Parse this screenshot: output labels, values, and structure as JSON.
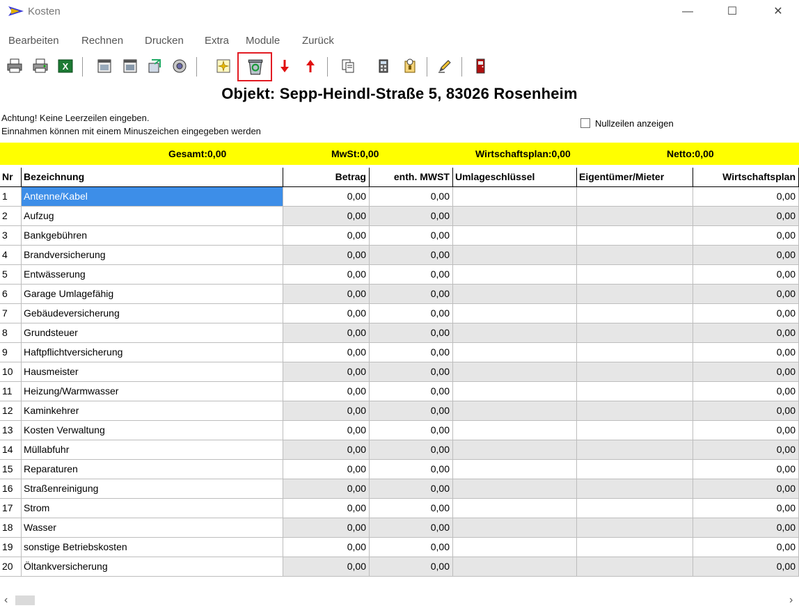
{
  "window": {
    "title": "Kosten"
  },
  "menu": [
    "Bearbeiten",
    "Rechnen",
    "Drucken",
    "Extra",
    "Module",
    "Zurück"
  ],
  "heading": "Objekt: Sepp-Heindl-Straße 5, 83026 Rosenheim",
  "notes": {
    "line1": "Achtung!  Keine Leerzeilen eingeben.",
    "line2": "Einnahmen können mit einem  Minuszeichen eingegeben werden"
  },
  "null_rows_label": "Nullzeilen anzeigen",
  "totals": {
    "gesamt": "Gesamt:0,00",
    "mwst": "MwSt:0,00",
    "wirtschaftsplan": "Wirtschaftsplan:0,00",
    "netto": "Netto:0,00"
  },
  "table": {
    "headers": [
      "Nr",
      "Bezeichnung",
      "Betrag",
      "enth. MWST",
      "Umlageschlüssel",
      "Eigentümer/Mieter",
      "Wirtschaftsplan"
    ],
    "rows": [
      {
        "nr": "1",
        "bez": "Antenne/Kabel",
        "betrag": "0,00",
        "mwst": "0,00",
        "umlage": "",
        "eig": "",
        "wp": "0,00"
      },
      {
        "nr": "2",
        "bez": "Aufzug",
        "betrag": "0,00",
        "mwst": "0,00",
        "umlage": "",
        "eig": "",
        "wp": "0,00"
      },
      {
        "nr": "3",
        "bez": "Bankgebühren",
        "betrag": "0,00",
        "mwst": "0,00",
        "umlage": "",
        "eig": "",
        "wp": "0,00"
      },
      {
        "nr": "4",
        "bez": "Brandversicherung",
        "betrag": "0,00",
        "mwst": "0,00",
        "umlage": "",
        "eig": "",
        "wp": "0,00"
      },
      {
        "nr": "5",
        "bez": "Entwässerung",
        "betrag": "0,00",
        "mwst": "0,00",
        "umlage": "",
        "eig": "",
        "wp": "0,00"
      },
      {
        "nr": "6",
        "bez": "Garage Umlagefähig",
        "betrag": "0,00",
        "mwst": "0,00",
        "umlage": "",
        "eig": "",
        "wp": "0,00"
      },
      {
        "nr": "7",
        "bez": "Gebäudeversicherung",
        "betrag": "0,00",
        "mwst": "0,00",
        "umlage": "",
        "eig": "",
        "wp": "0,00"
      },
      {
        "nr": "8",
        "bez": "Grundsteuer",
        "betrag": "0,00",
        "mwst": "0,00",
        "umlage": "",
        "eig": "",
        "wp": "0,00"
      },
      {
        "nr": "9",
        "bez": "Haftpflichtversicherung",
        "betrag": "0,00",
        "mwst": "0,00",
        "umlage": "",
        "eig": "",
        "wp": "0,00"
      },
      {
        "nr": "10",
        "bez": "Hausmeister",
        "betrag": "0,00",
        "mwst": "0,00",
        "umlage": "",
        "eig": "",
        "wp": "0,00"
      },
      {
        "nr": "11",
        "bez": "Heizung/Warmwasser",
        "betrag": "0,00",
        "mwst": "0,00",
        "umlage": "",
        "eig": "",
        "wp": "0,00"
      },
      {
        "nr": "12",
        "bez": "Kaminkehrer",
        "betrag": "0,00",
        "mwst": "0,00",
        "umlage": "",
        "eig": "",
        "wp": "0,00"
      },
      {
        "nr": "13",
        "bez": "Kosten Verwaltung",
        "betrag": "0,00",
        "mwst": "0,00",
        "umlage": "",
        "eig": "",
        "wp": "0,00"
      },
      {
        "nr": "14",
        "bez": "Müllabfuhr",
        "betrag": "0,00",
        "mwst": "0,00",
        "umlage": "",
        "eig": "",
        "wp": "0,00"
      },
      {
        "nr": "15",
        "bez": "Reparaturen",
        "betrag": "0,00",
        "mwst": "0,00",
        "umlage": "",
        "eig": "",
        "wp": "0,00"
      },
      {
        "nr": "16",
        "bez": "Straßenreinigung",
        "betrag": "0,00",
        "mwst": "0,00",
        "umlage": "",
        "eig": "",
        "wp": "0,00"
      },
      {
        "nr": "17",
        "bez": "Strom",
        "betrag": "0,00",
        "mwst": "0,00",
        "umlage": "",
        "eig": "",
        "wp": "0,00"
      },
      {
        "nr": "18",
        "bez": "Wasser",
        "betrag": "0,00",
        "mwst": "0,00",
        "umlage": "",
        "eig": "",
        "wp": "0,00"
      },
      {
        "nr": "19",
        "bez": "sonstige Betriebskosten",
        "betrag": "0,00",
        "mwst": "0,00",
        "umlage": "",
        "eig": "",
        "wp": "0,00"
      },
      {
        "nr": "20",
        "bez": "Öltankversicherung",
        "betrag": "0,00",
        "mwst": "0,00",
        "umlage": "",
        "eig": "",
        "wp": "0,00"
      }
    ]
  },
  "toolbar_icons": [
    "printer-icon",
    "printer-preview-icon",
    "excel-icon",
    "calendar-icon",
    "calendar-alt-icon",
    "import-icon",
    "settings-icon",
    "sparkle-icon",
    "recycle-bin-icon",
    "arrow-down-icon",
    "arrow-up-icon",
    "copy-icon",
    "calculator-icon",
    "key-icon",
    "pencil-icon",
    "exit-door-icon"
  ],
  "colors": {
    "totals_bar": "#ffff00",
    "selection": "#3d8ee8",
    "highlight": "#e21b23",
    "row_alt": "#e6e6e6"
  }
}
